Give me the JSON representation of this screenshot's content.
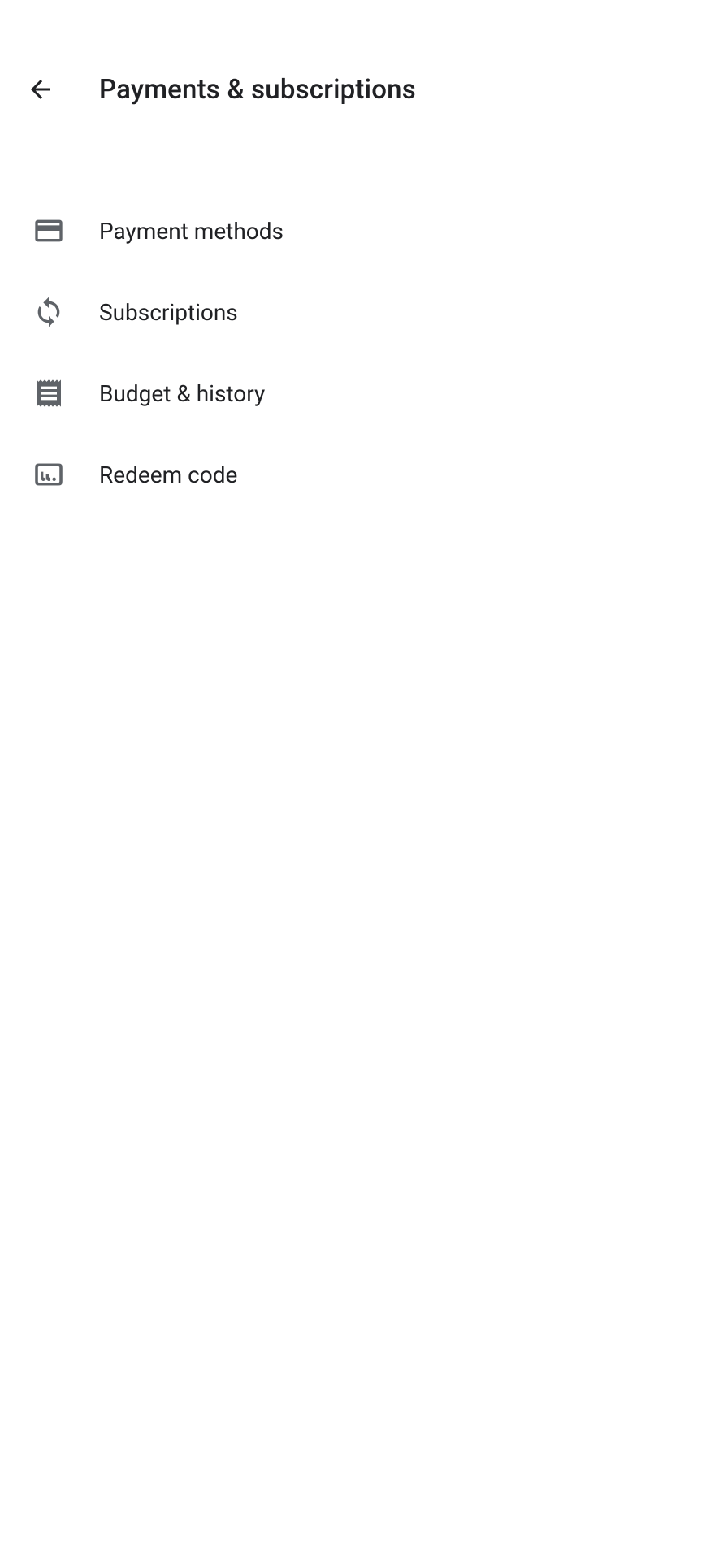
{
  "header": {
    "title": "Payments & subscriptions"
  },
  "menu": {
    "items": [
      {
        "label": "Payment methods"
      },
      {
        "label": "Subscriptions"
      },
      {
        "label": "Budget & history"
      },
      {
        "label": "Redeem code"
      }
    ]
  }
}
